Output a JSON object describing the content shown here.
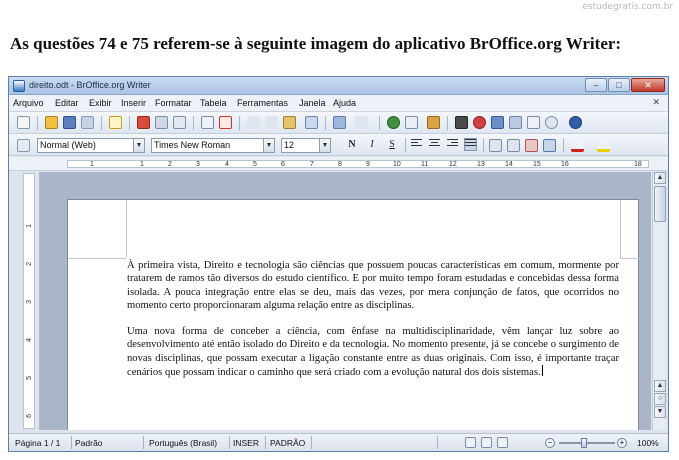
{
  "watermark": "estudegratis.com.br",
  "question": "As questões 74 e 75 referem-se à seguinte imagem do aplicativo BrOffice.org Writer:",
  "window": {
    "title": "direito.odt - BrOffice.org Writer",
    "buttons": {
      "minimize": "–",
      "maximize": "□",
      "close": "✕"
    }
  },
  "menu": {
    "items": [
      "Arquivo",
      "Editar",
      "Exibir",
      "Inserir",
      "Formatar",
      "Tabela",
      "Ferramentas",
      "Janela",
      "Ajuda"
    ],
    "close_doc": "✕"
  },
  "formatting": {
    "style": "Normal (Web)",
    "font": "Times New Roman",
    "size": "12",
    "bold": "N",
    "italic": "I",
    "underline": "S"
  },
  "ruler": {
    "labels": [
      "1",
      "1",
      "2",
      "3",
      "4",
      "5",
      "6",
      "7",
      "8",
      "9",
      "10",
      "11",
      "12",
      "13",
      "14",
      "15",
      "16",
      "18"
    ],
    "vertical_labels": [
      "1",
      "2",
      "3",
      "4",
      "5",
      "6"
    ]
  },
  "document": {
    "paragraphs": [
      "À primeira vista, Direito e tecnologia são ciências que possuem poucas características em comum, mormente por tratarem de ramos tão diversos do estudo científico. E por muito tempo foram estudadas e concebidas dessa forma isolada. A pouca integração entre elas se deu, mais das vezes, por mera conjunção de fatos, que ocorridos no momento certo proporcionaram alguma relação entre as disciplinas.",
      "Uma nova forma de conceber a ciência, com ênfase na multidisciplinaridade, vêm lançar luz sobre ao desenvolvimento até então isolado do Direito e da tecnologia. No momento presente, já se concebe o surgimento de novas disciplinas, que possam executar a ligação constante entre as duas originais. Com isso, é importante traçar cenários que possam indicar o caminho que será criado com a evolução natural dos dois sistemas."
    ]
  },
  "status": {
    "page": "Página 1 / 1",
    "style": "Padrão",
    "language": "Português (Brasil)",
    "insert_mode": "INSER",
    "selection_mode": "PADRÃO",
    "zoom": "100%"
  }
}
